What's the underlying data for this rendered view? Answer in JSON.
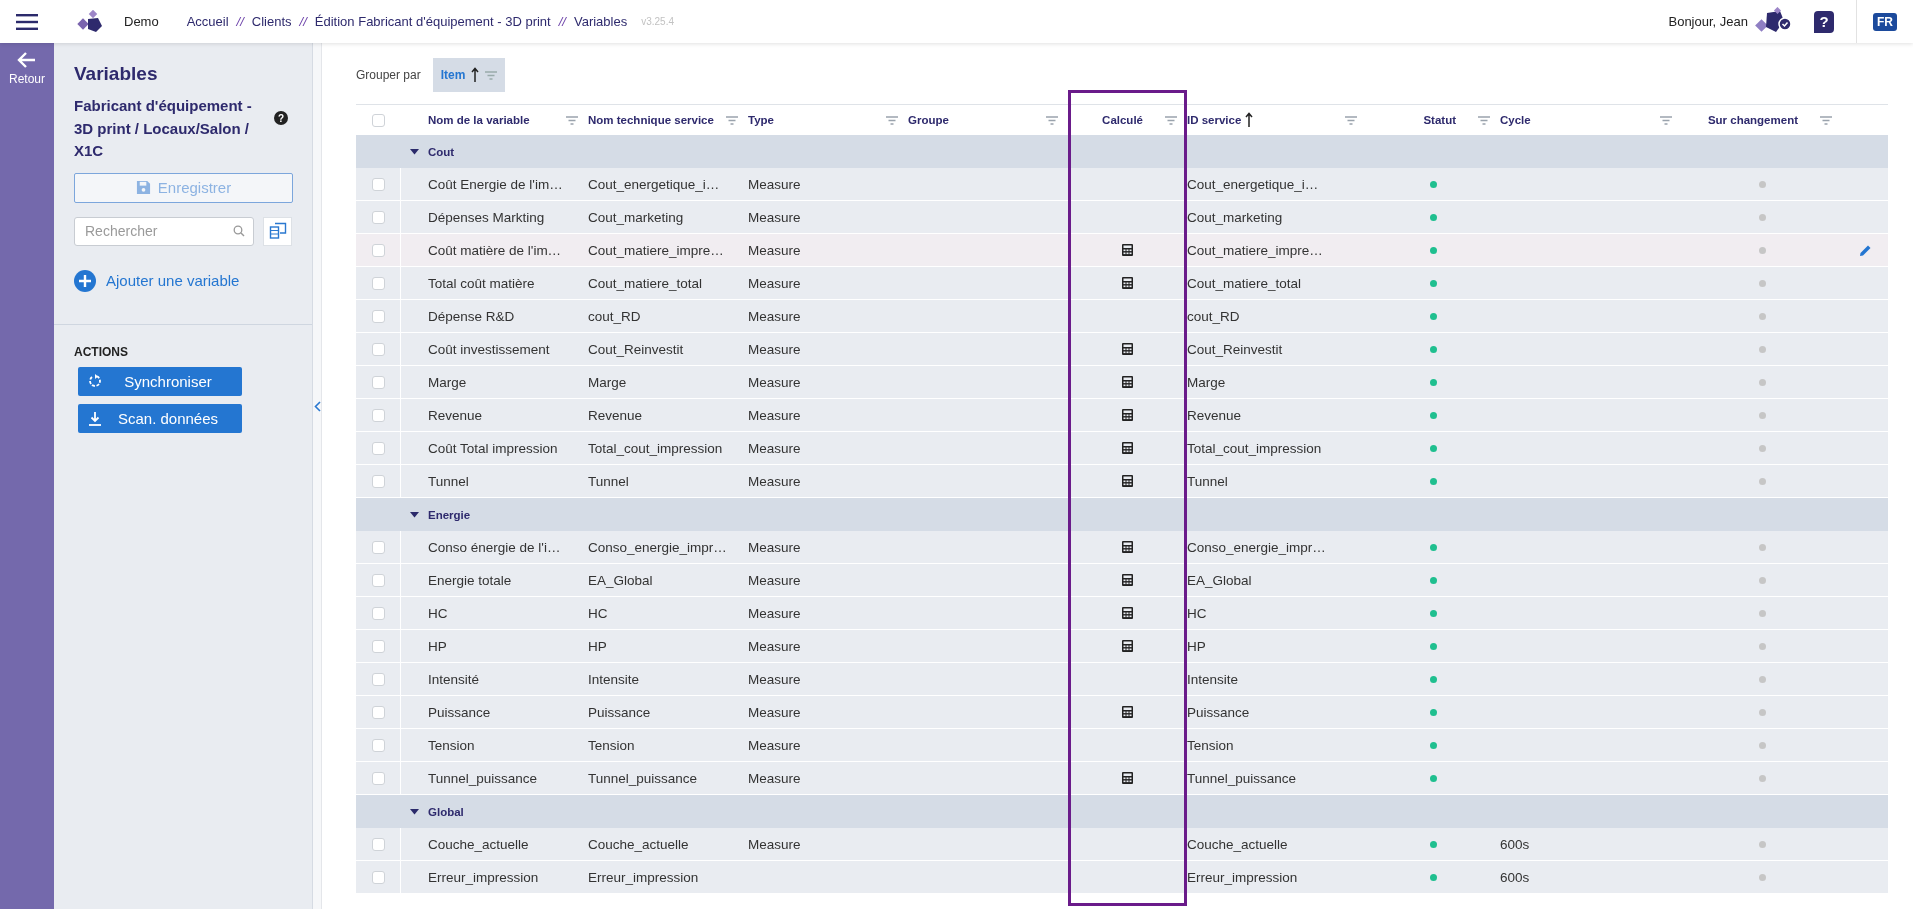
{
  "topbar": {
    "app": "Demo",
    "breadcrumbs": [
      "Accueil",
      "Clients",
      "Édition Fabricant d'équipement - 3D print",
      "Variables"
    ],
    "separator": "//",
    "version": "v3.25.4",
    "greeting": "Bonjour, Jean",
    "help": "?",
    "language": "FR"
  },
  "rail": {
    "back": "Retour"
  },
  "panel": {
    "title": "Variables",
    "subtitle": "Fabricant d'équipement - 3D print / Locaux/Salon / X1C",
    "info": "?",
    "save": {
      "label": "Enregistrer",
      "disabled": true
    },
    "search": {
      "placeholder": "Rechercher"
    },
    "add": "Ajouter une variable",
    "actions_title": "ACTIONS",
    "actions": [
      {
        "kind": "sync",
        "label": "Synchroniser"
      },
      {
        "kind": "scan",
        "label": "Scan. données"
      }
    ]
  },
  "groupby": {
    "label": "Grouper par",
    "chip": "Item",
    "sorted": true
  },
  "table": {
    "select_all_checked": false,
    "columns": [
      {
        "label": "Nom de la variable",
        "kind": "text",
        "sorted": false,
        "highlighted": false
      },
      {
        "label": "Nom technique service",
        "kind": "text",
        "sorted": false,
        "highlighted": false
      },
      {
        "label": "Type",
        "kind": "text",
        "sorted": false,
        "highlighted": false
      },
      {
        "label": "Groupe",
        "kind": "text",
        "sorted": false,
        "highlighted": false
      },
      {
        "label": "Calculé",
        "kind": "icon",
        "sorted": false,
        "highlighted": true
      },
      {
        "label": "ID service",
        "kind": "text",
        "sorted": true,
        "highlighted": false
      },
      {
        "label": "Statut",
        "kind": "dot",
        "sorted": false,
        "highlighted": false
      },
      {
        "label": "Cycle",
        "kind": "text",
        "sorted": false,
        "highlighted": false
      },
      {
        "label": "Sur changement",
        "kind": "dot",
        "sorted": false,
        "highlighted": false
      }
    ],
    "groups": [
      {
        "name": "Cout",
        "expanded": true,
        "rows": [
          {
            "name": "Coût Energie de l'im…",
            "tech": "Cout_energetique_i…",
            "type": "Measure",
            "calculated": false,
            "id": "Cout_energetique_i…",
            "active": true,
            "on_change": false,
            "checked": false,
            "hovered": false
          },
          {
            "name": "Dépenses Markting",
            "tech": "Cout_marketing",
            "type": "Measure",
            "calculated": false,
            "id": "Cout_marketing",
            "active": true,
            "on_change": false,
            "checked": false,
            "hovered": false
          },
          {
            "name": "Coût matière de l'im…",
            "tech": "Cout_matiere_impre…",
            "type": "Measure",
            "calculated": true,
            "id": "Cout_matiere_impre…",
            "active": true,
            "on_change": false,
            "checked": false,
            "hovered": true
          },
          {
            "name": "Total coût matière",
            "tech": "Cout_matiere_total",
            "type": "Measure",
            "calculated": true,
            "id": "Cout_matiere_total",
            "active": true,
            "on_change": false,
            "checked": false,
            "hovered": false
          },
          {
            "name": "Dépense R&D",
            "tech": "cout_RD",
            "type": "Measure",
            "calculated": false,
            "id": "cout_RD",
            "active": true,
            "on_change": false,
            "checked": false,
            "hovered": false
          },
          {
            "name": "Coût investissement",
            "tech": "Cout_Reinvestit",
            "type": "Measure",
            "calculated": true,
            "id": "Cout_Reinvestit",
            "active": true,
            "on_change": false,
            "checked": false,
            "hovered": false
          },
          {
            "name": "Marge",
            "tech": "Marge",
            "type": "Measure",
            "calculated": true,
            "id": "Marge",
            "active": true,
            "on_change": false,
            "checked": false,
            "hovered": false
          },
          {
            "name": "Revenue",
            "tech": "Revenue",
            "type": "Measure",
            "calculated": true,
            "id": "Revenue",
            "active": true,
            "on_change": false,
            "checked": false,
            "hovered": false
          },
          {
            "name": "Coût Total impression",
            "tech": "Total_cout_impression",
            "type": "Measure",
            "calculated": true,
            "id": "Total_cout_impression",
            "active": true,
            "on_change": false,
            "checked": false,
            "hovered": false
          },
          {
            "name": "Tunnel",
            "tech": "Tunnel",
            "type": "Measure",
            "calculated": true,
            "id": "Tunnel",
            "active": true,
            "on_change": false,
            "checked": false,
            "hovered": false
          }
        ]
      },
      {
        "name": "Energie",
        "expanded": true,
        "rows": [
          {
            "name": "Conso énergie de l'i…",
            "tech": "Conso_energie_impr…",
            "type": "Measure",
            "calculated": true,
            "id": "Conso_energie_impr…",
            "active": true,
            "on_change": false,
            "checked": false,
            "hovered": false
          },
          {
            "name": "Energie totale",
            "tech": "EA_Global",
            "type": "Measure",
            "calculated": true,
            "id": "EA_Global",
            "active": true,
            "on_change": false,
            "checked": false,
            "hovered": false
          },
          {
            "name": "HC",
            "tech": "HC",
            "type": "Measure",
            "calculated": true,
            "id": "HC",
            "active": true,
            "on_change": false,
            "checked": false,
            "hovered": false
          },
          {
            "name": "HP",
            "tech": "HP",
            "type": "Measure",
            "calculated": true,
            "id": "HP",
            "active": true,
            "on_change": false,
            "checked": false,
            "hovered": false
          },
          {
            "name": "Intensité",
            "tech": "Intensite",
            "type": "Measure",
            "calculated": false,
            "id": "Intensite",
            "active": true,
            "on_change": false,
            "checked": false,
            "hovered": false
          },
          {
            "name": "Puissance",
            "tech": "Puissance",
            "type": "Measure",
            "calculated": true,
            "id": "Puissance",
            "active": true,
            "on_change": false,
            "checked": false,
            "hovered": false
          },
          {
            "name": "Tension",
            "tech": "Tension",
            "type": "Measure",
            "calculated": false,
            "id": "Tension",
            "active": true,
            "on_change": false,
            "checked": false,
            "hovered": false
          },
          {
            "name": "Tunnel_puissance",
            "tech": "Tunnel_puissance",
            "type": "Measure",
            "calculated": true,
            "id": "Tunnel_puissance",
            "active": true,
            "on_change": false,
            "checked": false,
            "hovered": false
          }
        ]
      },
      {
        "name": "Global",
        "expanded": true,
        "rows": [
          {
            "name": "Couche_actuelle",
            "tech": "Couche_actuelle",
            "type": "Measure",
            "calculated": false,
            "id": "Couche_actuelle",
            "active": true,
            "cycle": "600s",
            "on_change": false,
            "checked": false,
            "hovered": false
          },
          {
            "name": "Erreur_impression",
            "tech": "Erreur_impression",
            "calculated": false,
            "id": "Erreur_impression",
            "active": true,
            "cycle": "600s",
            "on_change": false,
            "checked": false,
            "hovered": false
          }
        ]
      }
    ]
  }
}
